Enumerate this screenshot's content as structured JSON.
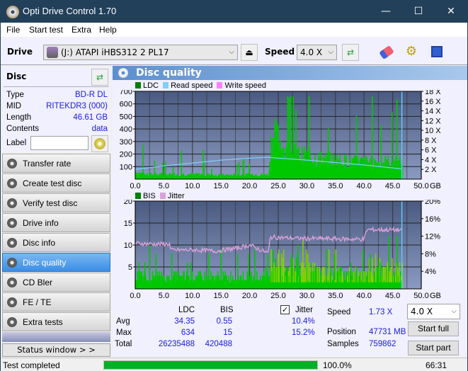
{
  "window": {
    "title": "Opti Drive Control 1.70",
    "minimize": "—",
    "maximize": "☐",
    "close": "✕"
  },
  "menu": [
    "File",
    "Start test",
    "Extra",
    "Help"
  ],
  "toolbar": {
    "drive_label": "Drive",
    "drive_value": "(J:)  ATAPI iHBS312  2 PL17",
    "speed_label": "Speed",
    "speed_value": "4.0 X"
  },
  "disc": {
    "title": "Disc",
    "rows": [
      {
        "label": "Type",
        "value": "BD-R DL"
      },
      {
        "label": "MID",
        "value": "RITEKDR3 (000)"
      },
      {
        "label": "Length",
        "value": "46.61 GB"
      },
      {
        "label": "Contents",
        "value": "data"
      }
    ],
    "label_label": "Label",
    "label_value": ""
  },
  "nav": [
    {
      "label": "Transfer rate",
      "active": false
    },
    {
      "label": "Create test disc",
      "active": false
    },
    {
      "label": "Verify test disc",
      "active": false
    },
    {
      "label": "Drive info",
      "active": false
    },
    {
      "label": "Disc info",
      "active": false
    },
    {
      "label": "Disc quality",
      "active": true
    },
    {
      "label": "CD Bler",
      "active": false
    },
    {
      "label": "FE / TE",
      "active": false
    },
    {
      "label": "Extra tests",
      "active": false
    }
  ],
  "status_window_btn": "Status window > >",
  "panel_title": "Disc quality",
  "colors": {
    "ldc": "#00c000",
    "bis": "#00c000",
    "read_speed": "#7fd0ff",
    "write_speed": "#ff80ff",
    "jitter": "#d8a0d8",
    "plot_bg_top": "#4a5a80",
    "plot_bg_bottom": "#8a9ac0",
    "progress": "#06b025"
  },
  "chart_data": [
    {
      "type": "bar",
      "title": "LDC",
      "legend": [
        "LDC",
        "Read speed",
        "Write speed"
      ],
      "xlabel": "GB",
      "x_ticks": [
        "0.0",
        "5.0",
        "10.0",
        "15.0",
        "20.0",
        "25.0",
        "30.0",
        "35.0",
        "40.0",
        "45.0",
        "50.0"
      ],
      "xlim": [
        0,
        50
      ],
      "ylim": [
        0,
        700
      ],
      "y_ticks": [
        "100",
        "200",
        "300",
        "400",
        "500",
        "600",
        "700"
      ],
      "y2_ticks": [
        "2 X",
        "4 X",
        "6 X",
        "8 X",
        "10 X",
        "12 X",
        "14 X",
        "16 X",
        "18 X"
      ],
      "y2lim": [
        0,
        18
      ],
      "end_marker_gb": 46.61,
      "series": [
        {
          "name": "LDC",
          "x": [
            0,
            2,
            4,
            6,
            8,
            10,
            12,
            14,
            16,
            18,
            20,
            22,
            23.3,
            23.6,
            24,
            25,
            26,
            28,
            30,
            32,
            34,
            36,
            38,
            40,
            42,
            44,
            46.5
          ],
          "values": [
            60,
            40,
            40,
            40,
            45,
            40,
            40,
            35,
            35,
            35,
            40,
            40,
            40,
            300,
            400,
            350,
            250,
            220,
            200,
            180,
            170,
            160,
            150,
            150,
            150,
            150,
            140
          ]
        },
        {
          "name": "Read speed",
          "x": [
            0,
            5,
            10,
            15,
            20,
            23.3,
            25,
            30,
            35,
            40,
            46.6
          ],
          "values": [
            2.0,
            2.7,
            3.3,
            3.9,
            4.3,
            4.5,
            4.3,
            3.9,
            3.4,
            2.9,
            2.1
          ]
        }
      ]
    },
    {
      "type": "bar",
      "title": "BIS",
      "legend": [
        "BIS",
        "Jitter"
      ],
      "xlabel": "GB",
      "x_ticks": [
        "0.0",
        "5.0",
        "10.0",
        "15.0",
        "20.0",
        "25.0",
        "30.0",
        "35.0",
        "40.0",
        "45.0",
        "50.0"
      ],
      "xlim": [
        0,
        50
      ],
      "ylim": [
        0,
        20
      ],
      "y_ticks": [
        "5",
        "10",
        "15",
        "20"
      ],
      "y2_ticks": [
        "4%",
        "8%",
        "12%",
        "16%",
        "20%"
      ],
      "y2lim": [
        0,
        20
      ],
      "end_marker_gb": 46.61,
      "series": [
        {
          "name": "BIS",
          "x": [
            0,
            5,
            10,
            15,
            20,
            23.3,
            23.6,
            25,
            30,
            35,
            40,
            41,
            46.5
          ],
          "values": [
            3,
            3,
            3,
            3,
            3,
            3,
            8,
            7,
            5,
            4,
            4,
            6,
            6
          ]
        },
        {
          "name": "Jitter",
          "x": [
            0,
            3,
            6,
            6.2,
            10,
            14,
            18,
            20,
            22,
            23.3,
            23.6,
            28,
            35,
            40,
            40.5,
            46.5
          ],
          "values": [
            10.4,
            10.2,
            10.2,
            8.8,
            8.9,
            8.6,
            9.3,
            10.0,
            8.8,
            8.2,
            11.8,
            11.5,
            11.4,
            11.3,
            13.5,
            13.4
          ]
        }
      ]
    }
  ],
  "stats": {
    "headers": [
      "LDC",
      "BIS"
    ],
    "rows": [
      {
        "label": "Avg",
        "ldc": "34.35",
        "bis": "0.55",
        "jitter": "10.4%"
      },
      {
        "label": "Max",
        "ldc": "634",
        "bis": "15",
        "jitter": "15.2%"
      },
      {
        "label": "Total",
        "ldc": "26235488",
        "bis": "420488"
      }
    ],
    "jitter_label": "Jitter",
    "jitter_checked": true,
    "speed_label": "Speed",
    "speed_value": "1.73 X",
    "position_label": "Position",
    "position_value": "47731 MB",
    "samples_label": "Samples",
    "samples_value": "759862",
    "speed_select": "4.0 X",
    "start_full": "Start full",
    "start_part": "Start part"
  },
  "statusbar": {
    "text": "Test completed",
    "progress": 100.0,
    "percent": "100.0%",
    "time": "66:31"
  }
}
